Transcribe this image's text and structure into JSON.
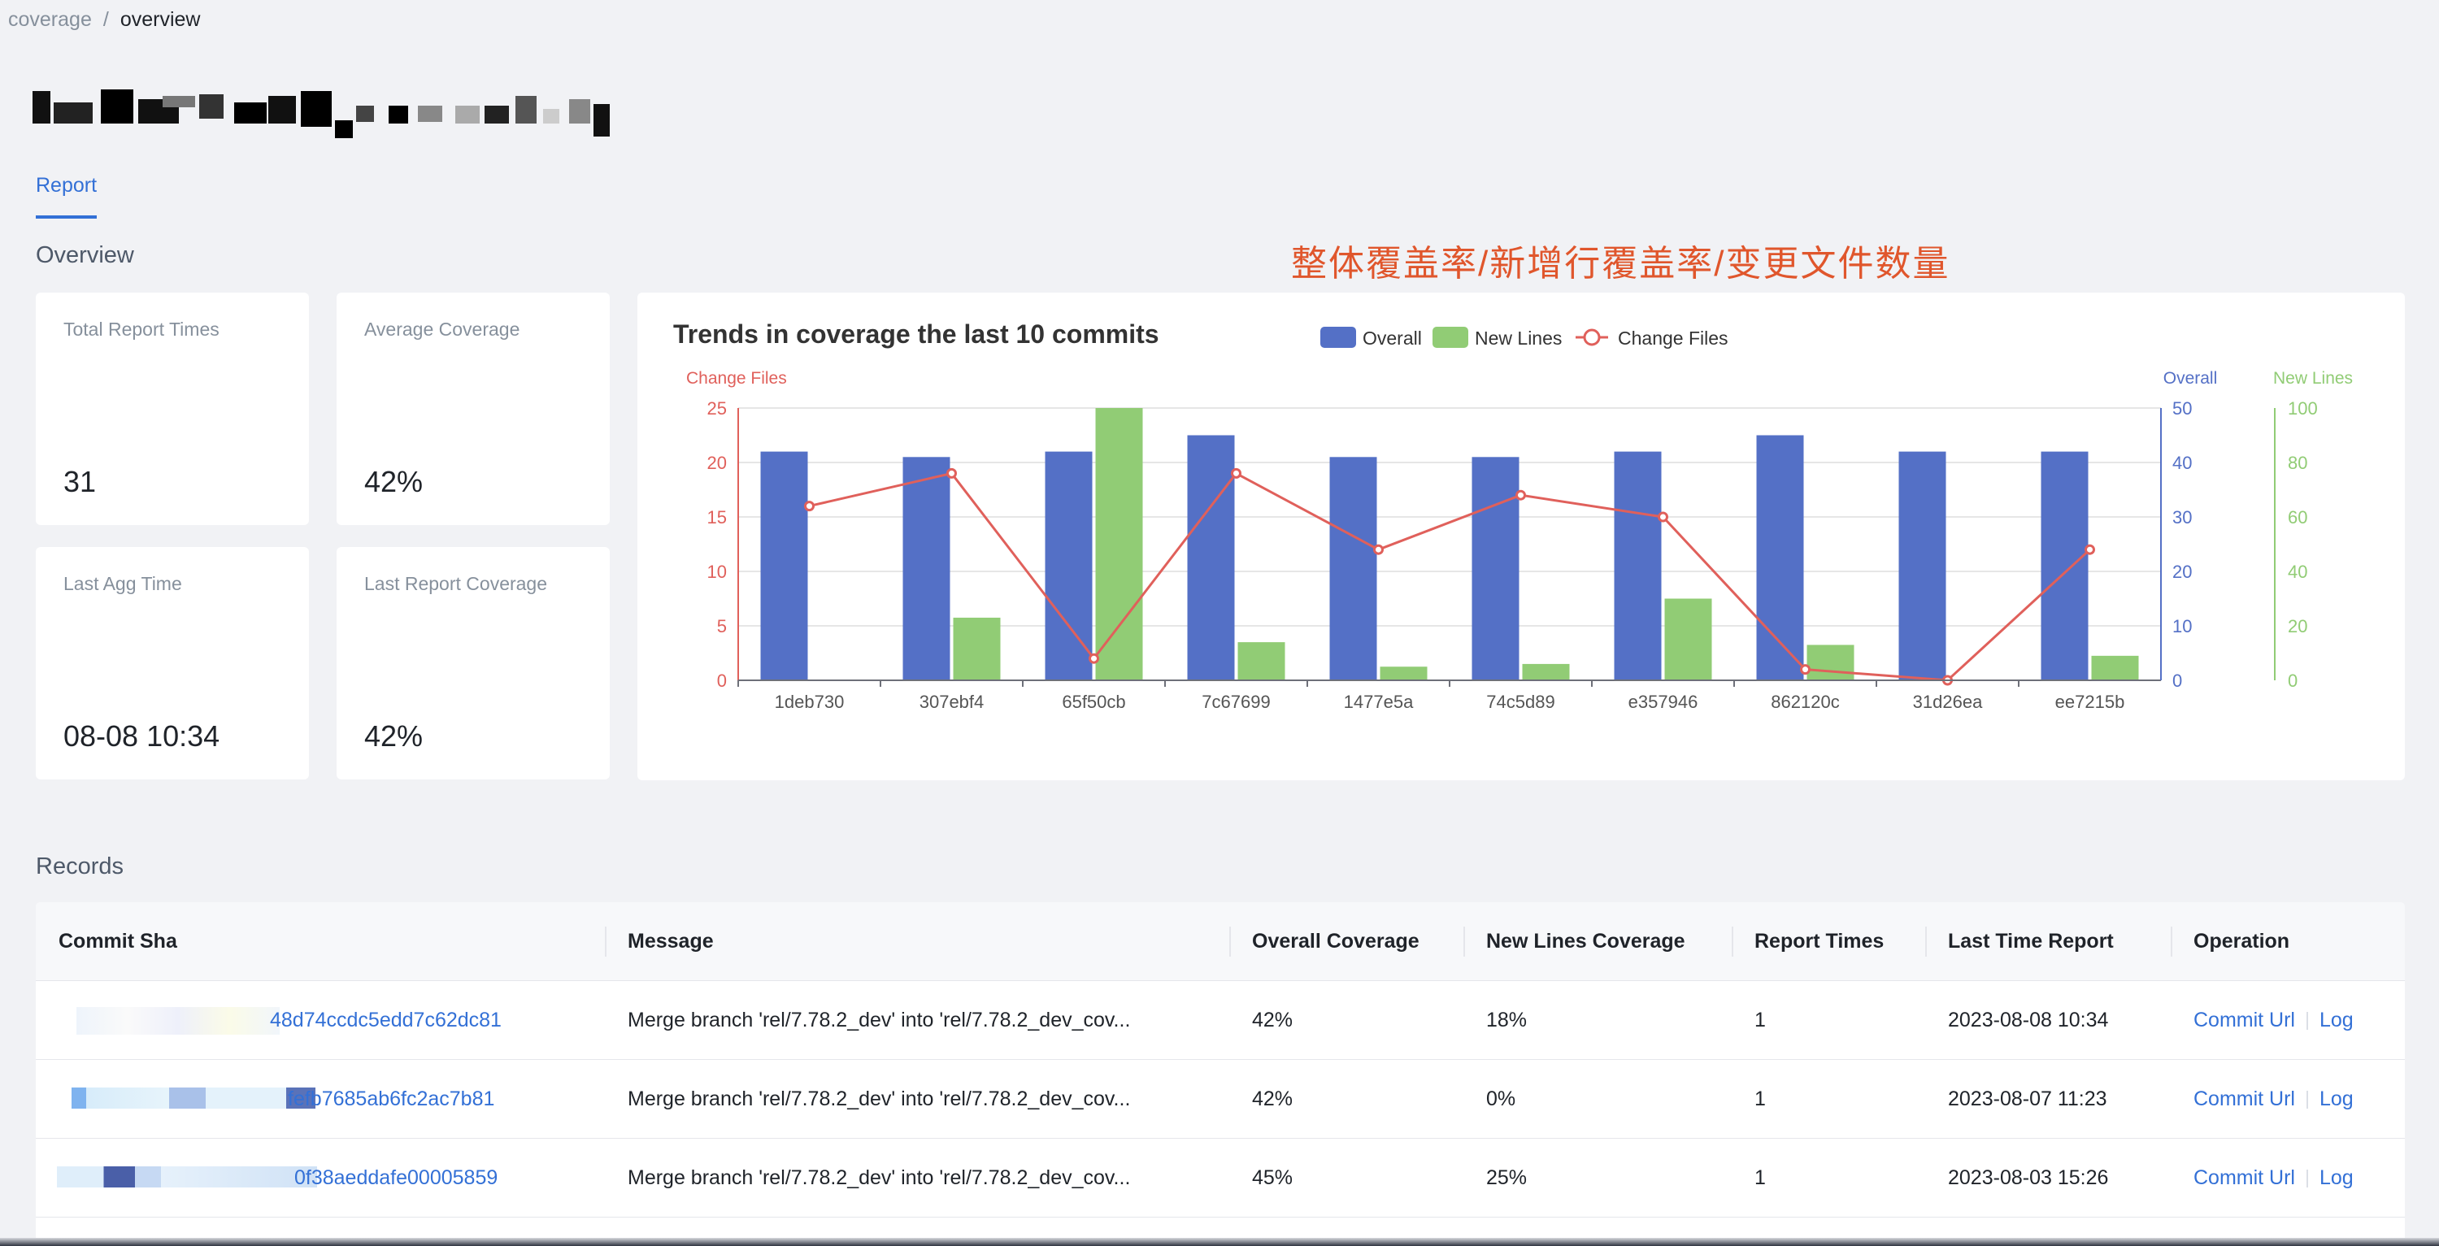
{
  "breadcrumb": {
    "items": [
      "coverage",
      "overview"
    ],
    "separator": "/"
  },
  "tabs": [
    {
      "label": "Report",
      "active": true
    }
  ],
  "sections": {
    "overview": "Overview",
    "records": "Records"
  },
  "annotation": "整体覆盖率/新增行覆盖率/变更文件数量",
  "stats": [
    {
      "label": "Total Report Times",
      "value": "31"
    },
    {
      "label": "Average Coverage",
      "value": "42%"
    },
    {
      "label": "Last Agg Time",
      "value": "08-08 10:34"
    },
    {
      "label": "Last Report Coverage",
      "value": "42%"
    }
  ],
  "colors": {
    "accent": "#3370d6",
    "overall": "#5470c6",
    "new_lines": "#91cc75",
    "change_files": "#e0605b",
    "annotation": "#e0562c"
  },
  "chart_data": {
    "type": "bar",
    "title": "Trends in coverage the last 10 commits",
    "legend_position": "top",
    "categories": [
      "1deb730",
      "307ebf4",
      "65f50cb",
      "7c67699",
      "1477e5a",
      "74c5d89",
      "e357946",
      "862120c",
      "31d26ea",
      "ee7215b"
    ],
    "series": [
      {
        "name": "Overall",
        "type": "bar",
        "axis": "Overall",
        "values": [
          42,
          41,
          42,
          45,
          41,
          41,
          42,
          45,
          42,
          42
        ]
      },
      {
        "name": "New Lines",
        "type": "bar",
        "axis": "New Lines",
        "values": [
          0,
          23,
          100,
          14,
          5,
          6,
          30,
          13,
          0,
          9
        ]
      },
      {
        "name": "Change Files",
        "type": "line",
        "axis": "Change Files",
        "values": [
          16,
          19,
          2,
          19,
          12,
          17,
          15,
          1,
          0,
          12
        ]
      }
    ],
    "axes": {
      "change_files": {
        "label": "Change Files",
        "ylim": [
          0,
          25
        ],
        "ticks": [
          "0",
          "5",
          "10",
          "15",
          "20",
          "25"
        ]
      },
      "overall": {
        "label": "Overall",
        "ylim": [
          0,
          50
        ],
        "ticks": [
          "0",
          "10",
          "20",
          "30",
          "40",
          "50"
        ]
      },
      "new_lines": {
        "label": "New Lines",
        "ylim": [
          0,
          100
        ],
        "ticks": [
          "0",
          "20",
          "40",
          "60",
          "80",
          "100"
        ]
      }
    },
    "grid": true
  },
  "table": {
    "columns": [
      "Commit Sha",
      "Message",
      "Overall Coverage",
      "New Lines Coverage",
      "Report Times",
      "Last Time Report",
      "Operation"
    ],
    "rows": [
      {
        "sha": "48d74ccdc5edd7c62dc81",
        "message": "Merge branch 'rel/7.78.2_dev' into 'rel/7.78.2_dev_cov...",
        "overall": "42%",
        "new_lines": "18%",
        "times": "1",
        "last": "2023-08-08 10:34"
      },
      {
        "sha": "fefb7685ab6fc2ac7b81",
        "message": "Merge branch 'rel/7.78.2_dev' into 'rel/7.78.2_dev_cov...",
        "overall": "42%",
        "new_lines": "0%",
        "times": "1",
        "last": "2023-08-07 11:23"
      },
      {
        "sha": "0f38aeddafe00005859",
        "message": "Merge branch 'rel/7.78.2_dev' into 'rel/7.78.2_dev_cov...",
        "overall": "45%",
        "new_lines": "25%",
        "times": "1",
        "last": "2023-08-03 15:26"
      }
    ],
    "operations": {
      "commit_url": "Commit Url",
      "log": "Log"
    }
  }
}
